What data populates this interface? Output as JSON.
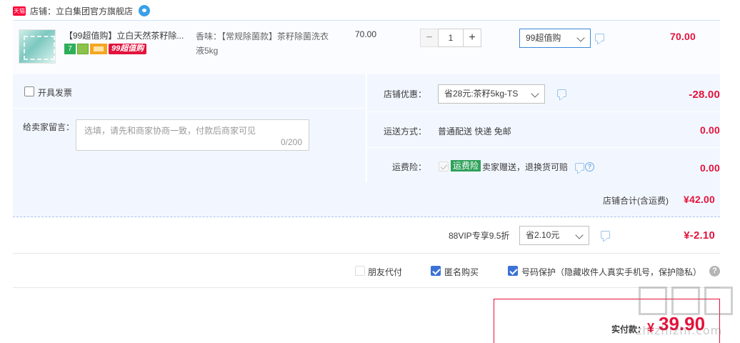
{
  "shop": {
    "logo_text": "天猫",
    "label": "店铺：",
    "name": "立白集团官方旗舰店"
  },
  "item": {
    "title": "【99超值购】立白天然茶籽除...",
    "badge_seven": "7",
    "badge_99": "99超值购",
    "sku": "香味：【常规除菌款】茶籽除菌洗衣液5kg",
    "unit_price": "70.00",
    "qty_minus": "−",
    "qty_plus": "+",
    "quantity": "1",
    "promo_select": "99超值购",
    "amount": "70.00"
  },
  "options": {
    "invoice_label": "开具发票",
    "message_label": "给卖家留言：",
    "message_placeholder": "选填，请先和商家协商一致，付款后商家可见",
    "message_counter": "0/200",
    "shop_discount_label": "店铺优惠：",
    "shop_discount_value": "省28元:茶籽5kg-TS",
    "shop_discount_amount": "-28.00",
    "shipping_label": "运送方式：",
    "shipping_value": "普通配送 快递 免邮",
    "shipping_amount": "0.00",
    "insurance_label": "运费险：",
    "insurance_tag": "运费险",
    "insurance_text": "卖家赠送，退换货可赔",
    "insurance_amount": "0.00"
  },
  "subtotal": {
    "label": "店铺合计(含运费)",
    "amount": "¥42.00"
  },
  "vip": {
    "label": "88VIP专享9.5折",
    "select": "省2.10元",
    "amount": "¥-2.10"
  },
  "extras": {
    "friend_pay": "朋友代付",
    "anonymous": "匿名购买",
    "number_protect": "号码保护（隐藏收件人真实手机号，保护隐私）",
    "help": "?"
  },
  "payment": {
    "label": "实付款：",
    "currency": "¥",
    "value": "39.90"
  },
  "watermark": {
    "text": "zhizhizhi.com"
  },
  "colors": {
    "accent_red": "#e4123c",
    "accent_blue": "#3a72d6",
    "panel_bg": "#f2f7ff",
    "insurance_green": "#2fa15a"
  }
}
